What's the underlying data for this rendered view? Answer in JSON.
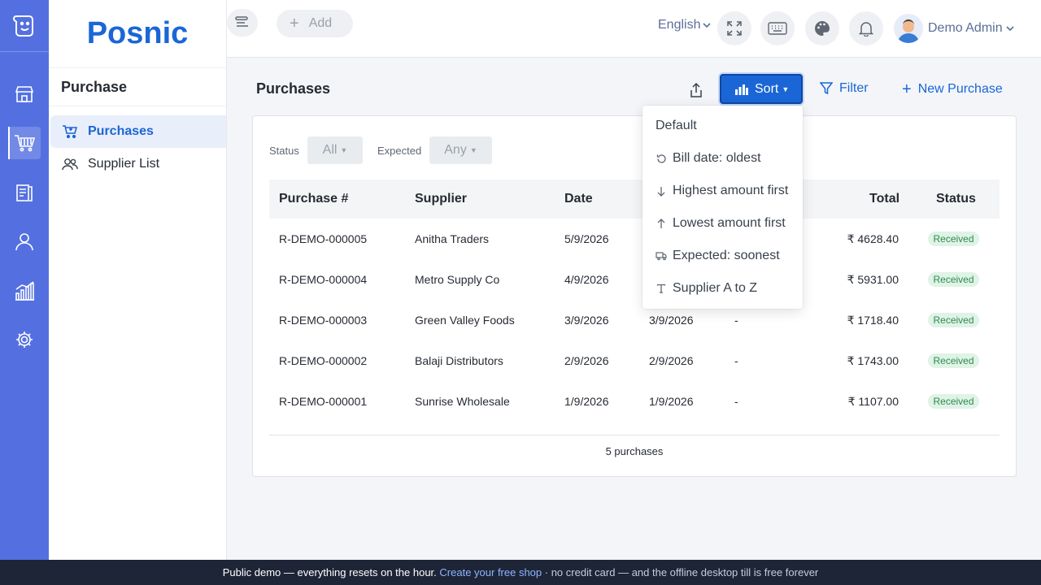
{
  "brand": "Posnic",
  "sidebar": {
    "section_title": "Purchase",
    "items": [
      {
        "label": "Purchases"
      },
      {
        "label": "Supplier List"
      }
    ]
  },
  "topbar": {
    "add_label": "Add",
    "language": "English",
    "user_name": "Demo Admin"
  },
  "page": {
    "title": "Purchases",
    "sort_label": "Sort",
    "filter_label": "Filter",
    "new_label": "New Purchase"
  },
  "filters": {
    "status_label": "Status",
    "status_value": "All",
    "expected_label": "Expected",
    "expected_value": "Any"
  },
  "table": {
    "columns": [
      "Purchase #",
      "Supplier",
      "Date",
      "Total",
      "Status"
    ],
    "rows": [
      {
        "id": "R-DEMO-000005",
        "supplier": "Anitha Traders",
        "date": "5/9/2026",
        "expected": "",
        "dash": "",
        "total": "₹ 4628.40",
        "status": "Received"
      },
      {
        "id": "R-DEMO-000004",
        "supplier": "Metro Supply Co",
        "date": "4/9/2026",
        "expected": "",
        "dash": "",
        "total": "₹ 5931.00",
        "status": "Received"
      },
      {
        "id": "R-DEMO-000003",
        "supplier": "Green Valley Foods",
        "date": "3/9/2026",
        "expected": "3/9/2026",
        "dash": "-",
        "total": "₹ 1718.40",
        "status": "Received"
      },
      {
        "id": "R-DEMO-000002",
        "supplier": "Balaji Distributors",
        "date": "2/9/2026",
        "expected": "2/9/2026",
        "dash": "-",
        "total": "₹ 1743.00",
        "status": "Received"
      },
      {
        "id": "R-DEMO-000001",
        "supplier": "Sunrise Wholesale",
        "date": "1/9/2026",
        "expected": "1/9/2026",
        "dash": "-",
        "total": "₹ 1107.00",
        "status": "Received"
      }
    ],
    "count_text": "5 purchases"
  },
  "sort_menu": {
    "items": [
      {
        "label": "Default",
        "icon": ""
      },
      {
        "label": "Bill date: oldest",
        "icon": "history-icon"
      },
      {
        "label": "Highest amount first",
        "icon": "arrow-down-icon"
      },
      {
        "label": "Lowest amount first",
        "icon": "arrow-up-icon"
      },
      {
        "label": "Expected: soonest",
        "icon": "truck-icon"
      },
      {
        "label": "Supplier A to Z",
        "icon": "text-icon"
      }
    ]
  },
  "footer": {
    "lead": "Public demo — everything resets on the hour.",
    "link": "Create your free shop",
    "trail": "· no credit card — and the offline desktop till is free forever"
  },
  "colors": {
    "rail": "#5470e0",
    "primary": "#1a66d6",
    "badge_bg": "#dff3e6",
    "badge_text": "#2f8a4f",
    "footer_bg": "#1d2537"
  }
}
